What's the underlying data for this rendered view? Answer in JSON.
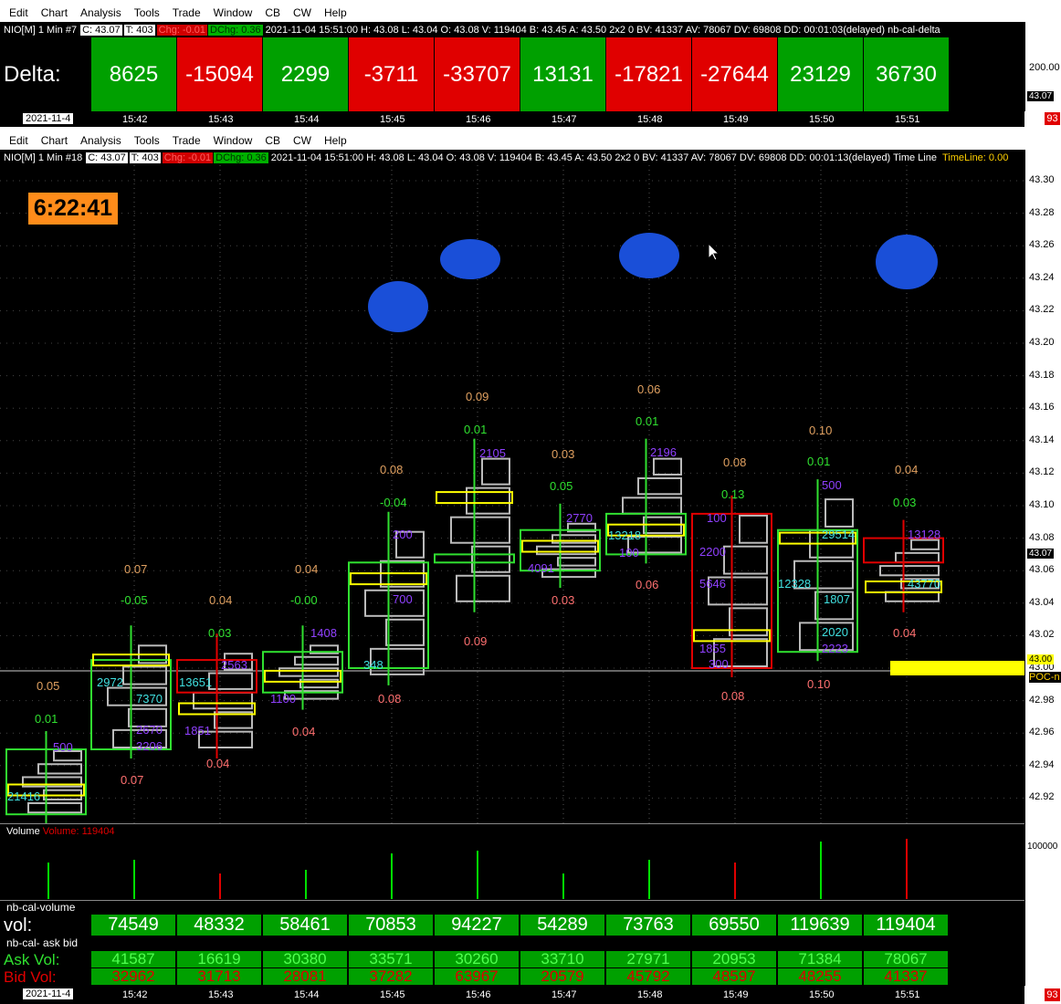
{
  "menu": [
    "Edit",
    "Chart",
    "Analysis",
    "Tools",
    "Trade",
    "Window",
    "CB",
    "CW",
    "Help"
  ],
  "top_info": {
    "symbol": "NIO[M]  1 Min  #7",
    "c": "C: 43.07",
    "t": "T: 403",
    "chg": "Chg: -0.01",
    "dchg": "DChg: 0.36",
    "rest": "2021-11-04 15:51:00 H: 43.08 L: 43.04 O: 43.08 V: 119404 B: 43.45 A: 43.50 2x2 0 BV: 41337 AV: 78067 DV: 69808 DD: 00:01:03(delayed) nb-cal-delta"
  },
  "bottom_info": {
    "symbol": "NIO[M]  1 Min  #18",
    "c": "C: 43.07",
    "t": "T: 403",
    "chg": "Chg: -0.01",
    "dchg": "DChg: 0.36",
    "rest": "2021-11-04 15:51:00 H: 43.08 L: 43.04 O: 43.08 V: 119404 B: 43.45 A: 43.50 2x2 0 BV: 41337 AV: 78067 DV: 69808 DD: 00:01:13(delayed) Time Line",
    "timeline": "TimeLine: 0.00"
  },
  "delta": {
    "label": "Delta:",
    "values": [
      "8625",
      "-15094",
      "2299",
      "-3711",
      "-33707",
      "13131",
      "-17821",
      "-27644",
      "23129",
      "36730"
    ],
    "colors": [
      "#00a000",
      "#e00000",
      "#00a000",
      "#e00000",
      "#e00000",
      "#00a000",
      "#e00000",
      "#e00000",
      "#00a000",
      "#00a000"
    ],
    "axis_label": "200.00",
    "price_tag": "43.07"
  },
  "time_labels": [
    "15:42",
    "15:43",
    "15:44",
    "15:45",
    "15:46",
    "15:47",
    "15:48",
    "15:49",
    "15:50",
    "15:51"
  ],
  "date": "2021-11-4",
  "badge": "93",
  "clock": "6:22:41",
  "price_axis": [
    "43.30",
    "43.28",
    "43.26",
    "43.24",
    "43.22",
    "43.20",
    "43.18",
    "43.16",
    "43.14",
    "43.12",
    "43.10",
    "43.08",
    "43.06",
    "43.04",
    "43.02",
    "43.00",
    "42.98",
    "42.96",
    "42.94",
    "42.92"
  ],
  "price_tag_main": "43.07",
  "price_tag_poc": "43.00",
  "poc_label": "POC-n",
  "footprint_labels": [
    {
      "t": "0.05",
      "c": "#e0a060"
    },
    {
      "t": "0.01",
      "c": "#30e030"
    },
    {
      "t": "500",
      "c": "#9040ff"
    },
    {
      "t": "21416",
      "c": "#40e0e0"
    },
    {
      "t": "0.07",
      "c": "#ff7070"
    },
    {
      "t": "0.07",
      "c": "#e0a060"
    },
    {
      "t": "-0.05",
      "c": "#30e030"
    },
    {
      "t": "2972",
      "c": "#40e0e0"
    },
    {
      "t": "7370",
      "c": "#40e0e0"
    },
    {
      "t": "2670",
      "c": "#9040ff"
    },
    {
      "t": "3206",
      "c": "#9040ff"
    },
    {
      "t": "0.04",
      "c": "#e0a060"
    },
    {
      "t": "0.03",
      "c": "#30e030"
    },
    {
      "t": "2563",
      "c": "#9040ff"
    },
    {
      "t": "13651",
      "c": "#40e0e0"
    },
    {
      "t": "1851",
      "c": "#9040ff"
    },
    {
      "t": "0.04",
      "c": "#ff7070"
    },
    {
      "t": "0.04",
      "c": "#e0a060"
    },
    {
      "t": "-0.00",
      "c": "#30e030"
    },
    {
      "t": "1408",
      "c": "#9040ff"
    },
    {
      "t": "1100",
      "c": "#9040ff"
    },
    {
      "t": "0.04",
      "c": "#ff7070"
    },
    {
      "t": "0.08",
      "c": "#e0a060"
    },
    {
      "t": "-0.04",
      "c": "#30e030"
    },
    {
      "t": "200",
      "c": "#9040ff"
    },
    {
      "t": "700",
      "c": "#9040ff"
    },
    {
      "t": "348",
      "c": "#40e0e0"
    },
    {
      "t": "0.08",
      "c": "#ff7070"
    },
    {
      "t": "0.09",
      "c": "#e0a060"
    },
    {
      "t": "0.01",
      "c": "#30e030"
    },
    {
      "t": "2105",
      "c": "#9040ff"
    },
    {
      "t": "0.09",
      "c": "#ff7070"
    },
    {
      "t": "0.03",
      "c": "#e0a060"
    },
    {
      "t": "0.05",
      "c": "#30e030"
    },
    {
      "t": "2770",
      "c": "#9040ff"
    },
    {
      "t": "4091",
      "c": "#9040ff"
    },
    {
      "t": "0.03",
      "c": "#ff7070"
    },
    {
      "t": "0.06",
      "c": "#e0a060"
    },
    {
      "t": "0.01",
      "c": "#30e030"
    },
    {
      "t": "2196",
      "c": "#9040ff"
    },
    {
      "t": "13218",
      "c": "#40e0e0"
    },
    {
      "t": "100",
      "c": "#9040ff"
    },
    {
      "t": "0.06",
      "c": "#ff7070"
    },
    {
      "t": "0.08",
      "c": "#e0a060"
    },
    {
      "t": "0.13",
      "c": "#30e030"
    },
    {
      "t": "100",
      "c": "#9040ff"
    },
    {
      "t": "2200",
      "c": "#9040ff"
    },
    {
      "t": "5646",
      "c": "#9040ff"
    },
    {
      "t": "1855",
      "c": "#9040ff"
    },
    {
      "t": "300",
      "c": "#9040ff"
    },
    {
      "t": "0.08",
      "c": "#ff7070"
    },
    {
      "t": "0.10",
      "c": "#e0a060"
    },
    {
      "t": "0.01",
      "c": "#30e030"
    },
    {
      "t": "500",
      "c": "#9040ff"
    },
    {
      "t": "29514",
      "c": "#40e0e0"
    },
    {
      "t": "12328",
      "c": "#40e0e0"
    },
    {
      "t": "1807",
      "c": "#40e0e0"
    },
    {
      "t": "2020",
      "c": "#40e0e0"
    },
    {
      "t": "2223",
      "c": "#9040ff"
    },
    {
      "t": "0.10",
      "c": "#ff7070"
    },
    {
      "t": "0.04",
      "c": "#e0a060"
    },
    {
      "t": "0.03",
      "c": "#30e030"
    },
    {
      "t": "13128",
      "c": "#9040ff"
    },
    {
      "t": "43770",
      "c": "#40e0e0"
    },
    {
      "t": "0.04",
      "c": "#ff7070"
    }
  ],
  "volume_panel": {
    "label": "Volume",
    "value": "Volume: 119404",
    "axis_label": "100000",
    "colors": [
      "#00e000",
      "#00e000",
      "#e00000",
      "#00e000",
      "#00e000",
      "#00e000",
      "#00e000",
      "#00e000",
      "#e00000",
      "#00e000",
      "#e00000"
    ]
  },
  "nb_cal_volume": {
    "label": "nb-cal-volume",
    "row_label": "vol:",
    "values": [
      "74549",
      "48332",
      "58461",
      "70853",
      "94227",
      "54289",
      "73763",
      "69550",
      "119639",
      "119404"
    ]
  },
  "ask_bid": {
    "label": "nb-cal- ask bid",
    "ask_label": "Ask Vol:",
    "bid_label": "Bid Vol:",
    "ask": [
      "41587",
      "16619",
      "30380",
      "33571",
      "30260",
      "33710",
      "27971",
      "20953",
      "71384",
      "78067"
    ],
    "bid": [
      "32962",
      "31713",
      "28081",
      "37282",
      "63967",
      "20579",
      "45792",
      "48597",
      "48255",
      "41337"
    ]
  }
}
